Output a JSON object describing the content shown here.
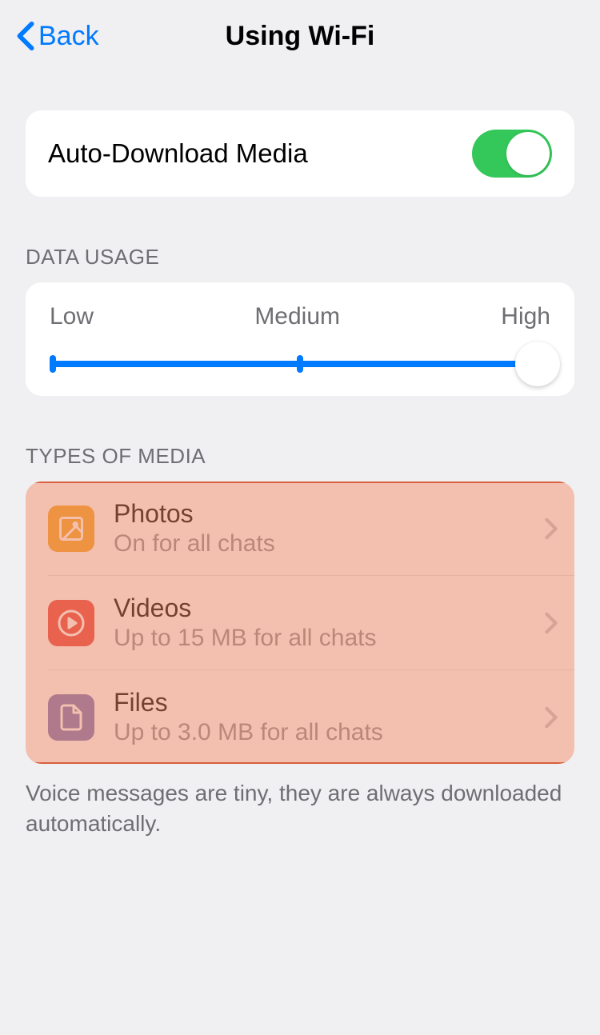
{
  "header": {
    "back_label": "Back",
    "title": "Using Wi-Fi"
  },
  "auto_download": {
    "label": "Auto-Download Media",
    "enabled": true
  },
  "data_usage": {
    "section_label": "DATA USAGE",
    "labels": [
      "Low",
      "Medium",
      "High"
    ],
    "value": "High"
  },
  "types_of_media": {
    "section_label": "TYPES OF MEDIA",
    "items": [
      {
        "title": "Photos",
        "subtitle": "On for all chats",
        "icon": "photos-icon"
      },
      {
        "title": "Videos",
        "subtitle": "Up to 15 MB for all chats",
        "icon": "videos-icon"
      },
      {
        "title": "Files",
        "subtitle": "Up to 3.0 MB for all chats",
        "icon": "files-icon"
      }
    ],
    "footer": "Voice messages are tiny, they are always downloaded automatically."
  },
  "colors": {
    "accent": "#007aff",
    "toggle_on": "#34c759",
    "photos": "#f5a623",
    "videos": "#e8443a",
    "files": "#7676b8"
  }
}
